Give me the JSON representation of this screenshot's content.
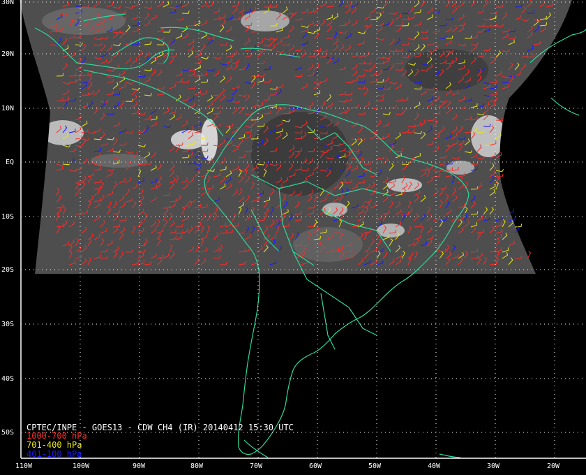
{
  "map": {
    "title": "CPTEC/INPE - GOES13 - CDW CH4 (IR) 20140412 15:30 UTC",
    "lat_labels": [
      "30N",
      "20N",
      "10N",
      "EQ",
      "10S",
      "20S",
      "30S",
      "40S",
      "50S"
    ],
    "lon_labels": [
      "110W",
      "100W",
      "90W",
      "80W",
      "70W",
      "60W",
      "50W",
      "40W",
      "30W",
      "20W"
    ],
    "legend": [
      {
        "label": "1000-700 hPa",
        "color": "#ff2a2a"
      },
      {
        "label": "701-400 hPa",
        "color": "#e8e81a"
      },
      {
        "label": "401-100 hPa",
        "color": "#1a1aff"
      }
    ],
    "colors": {
      "coast": "#2fd89a",
      "grid": "#ffffff",
      "imagery": "#505050",
      "background": "#000000"
    }
  }
}
